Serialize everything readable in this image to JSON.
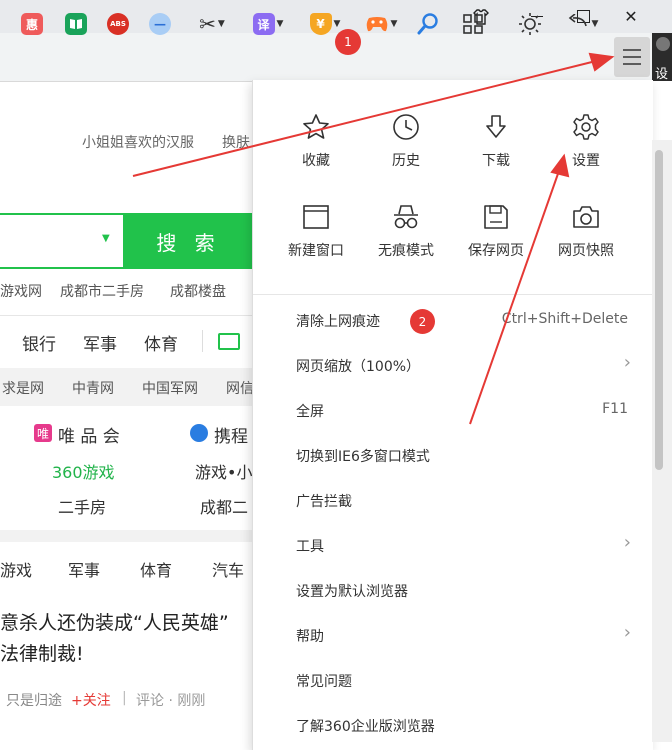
{
  "window": {
    "restore": "☐",
    "close": "✕",
    "minimize": "—",
    "user_text": "设"
  },
  "toolbar": {
    "extensions": [
      {
        "name": "hui",
        "glyph": "惠",
        "color": "#ef5b5b"
      },
      {
        "name": "book",
        "glyph": "▮",
        "color": "#1aa35a"
      },
      {
        "name": "abs",
        "glyph": "ABS",
        "color": "#d93025"
      },
      {
        "name": "minus",
        "glyph": "—",
        "color": "#7fb2f0"
      },
      {
        "name": "scissors",
        "glyph": "✂",
        "color": "#333333"
      },
      {
        "name": "translate",
        "glyph": "译",
        "color": "#8c6cf2"
      },
      {
        "name": "coupon",
        "glyph": "¥",
        "color": "#f5a623"
      },
      {
        "name": "game",
        "glyph": "●",
        "color": "#ff7a2d"
      }
    ],
    "badge_1": "1"
  },
  "page": {
    "promo_text": "小姐姐喜欢的汉服",
    "promo_text2": "换肤",
    "search_button": "搜 索",
    "quick_links": [
      "游戏网",
      "成都市二手房",
      "成都楼盘"
    ],
    "nav_tabs": [
      "银行",
      "军事",
      "体育"
    ],
    "site_links": [
      "求是网",
      "中青网",
      "中国军网",
      "网信"
    ],
    "sites_row1": [
      "唯 品 会",
      "携程"
    ],
    "sites_row2": [
      "360游戏",
      "游戏•小"
    ],
    "sites_row3": [
      "二手房",
      "成都二"
    ],
    "news_tabs": [
      "游戏",
      "军事",
      "体育",
      "汽车"
    ],
    "headline_line1": "意杀人还伪装成“人民英雄”",
    "headline_line2": "法律制裁!",
    "meta_author": "只是归途",
    "meta_follow": "+关注",
    "meta_sep": "|",
    "meta_comment": "评论 · 刚刚"
  },
  "menu": {
    "grid": [
      {
        "label": "收藏",
        "icon": "star-icon"
      },
      {
        "label": "历史",
        "icon": "clock-icon"
      },
      {
        "label": "下载",
        "icon": "download-icon"
      },
      {
        "label": "设置",
        "icon": "gear-icon"
      },
      {
        "label": "新建窗口",
        "icon": "window-icon"
      },
      {
        "label": "无痕模式",
        "icon": "incognito-icon"
      },
      {
        "label": "保存网页",
        "icon": "save-icon"
      },
      {
        "label": "网页快照",
        "icon": "camera-icon"
      }
    ],
    "items": [
      {
        "label": "清除上网痕迹",
        "shortcut": "Ctrl+Shift+Delete"
      },
      {
        "label": "网页缩放（100%）",
        "submenu": "›"
      },
      {
        "label": "全屏",
        "shortcut": "F11"
      },
      {
        "label": "切换到IE6多窗口模式"
      },
      {
        "label": "广告拦截"
      },
      {
        "label": "工具",
        "submenu": "›"
      },
      {
        "label": "设置为默认浏览器"
      },
      {
        "label": "帮助",
        "submenu": "›"
      },
      {
        "label": "常见问题"
      },
      {
        "label": "了解360企业版浏览器"
      }
    ],
    "badge_2": "2"
  },
  "colors": {
    "accent_green": "#21c24b",
    "annotation_red": "#e53935"
  }
}
